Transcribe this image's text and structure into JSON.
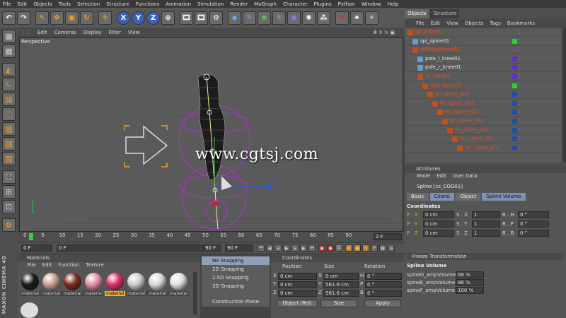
{
  "menubar": [
    "File",
    "Edit",
    "Objects",
    "Tools",
    "Selection",
    "Structure",
    "Functions",
    "Animation",
    "Simulation",
    "Render",
    "MoGraph",
    "Character",
    "Plugins",
    "Python",
    "Window",
    "Help"
  ],
  "toolbar": {
    "axis_x": "X",
    "axis_y": "Y",
    "axis_z": "Z"
  },
  "viewport": {
    "menu": [
      "Edit",
      "Cameras",
      "Display",
      "Filter",
      "View"
    ],
    "label": "Perspective",
    "watermark": "www.cgtsj.com"
  },
  "timeline": {
    "ticks": [
      "0",
      "5",
      "10",
      "15",
      "20",
      "25",
      "30",
      "35",
      "40",
      "45",
      "50",
      "55",
      "60",
      "65",
      "70",
      "75",
      "80",
      "85",
      "90"
    ],
    "end_label": "2 F",
    "current_frame": "0 F",
    "start_frame": "0 F",
    "end_frame": "90 F",
    "preview_end": "90 F"
  },
  "materials": {
    "title": "Materials",
    "menu": [
      "File",
      "Edit",
      "Function",
      "Texture"
    ],
    "items": [
      {
        "name": "material",
        "color": "#1a1a1a"
      },
      {
        "name": "material",
        "color": "#c8a090"
      },
      {
        "name": "material",
        "color": "#7a2a1a"
      },
      {
        "name": "material",
        "color": "#e890a8"
      },
      {
        "name": "material",
        "color": "#e0306a"
      },
      {
        "name": "material",
        "color": "#cccccc"
      },
      {
        "name": "material",
        "color": "#d8d8d8"
      },
      {
        "name": "material",
        "color": "#e0e0e0"
      }
    ],
    "selected_index": 4
  },
  "snapping": {
    "items": [
      "No Snapping",
      "2D Snapping",
      "2.5D Snapping",
      "3D Snapping",
      "Construction Plane"
    ],
    "active_index": 0
  },
  "coordinates": {
    "title": "Coordinates",
    "headers": [
      "Position",
      "Size",
      "Rotation"
    ],
    "rows": [
      {
        "axis": "X",
        "pos": "0 cm",
        "size": "0 cm",
        "rot_axis": "H",
        "rot": "0 °"
      },
      {
        "axis": "Y",
        "pos": "0 cm",
        "size": "561.6 cm",
        "rot_axis": "P",
        "rot": "0 °"
      },
      {
        "axis": "Z",
        "pos": "0 cm",
        "size": "561.6 cm",
        "rot_axis": "B",
        "rot": "0 °"
      }
    ],
    "mode": "Object (Rel)",
    "size_mode": "Size",
    "apply": "Apply"
  },
  "objects_panel": {
    "tabs": [
      "Objects",
      "Structure"
    ],
    "menu": [
      "File",
      "Edit",
      "View",
      "Objects",
      "Tags",
      "Bookmarks"
    ],
    "rows": [
      {
        "name": "sdcontrols",
        "indent": 0,
        "color": "",
        "red": true
      },
      {
        "name": "spl_spine01",
        "indent": 1,
        "color": "#30d030",
        "red": false
      },
      {
        "name": "ctGlobalMove01",
        "indent": 1,
        "color": "",
        "red": true
      },
      {
        "name": "pole_l_knee01",
        "indent": 2,
        "color": "#6030c0",
        "red": false
      },
      {
        "name": "pole_r_knee01",
        "indent": 2,
        "color": "#6030c0",
        "red": false
      },
      {
        "name": "cs_COG01",
        "indent": 2,
        "color": "#6030c0",
        "red": true
      },
      {
        "name": "mid_spine01",
        "indent": 3,
        "color": "#30d030",
        "red": true
      },
      {
        "name": "tin_spine_a01",
        "indent": 4,
        "color": "#2050a0",
        "red": true
      },
      {
        "name": "tin_spine_b01",
        "indent": 5,
        "color": "#2050a0",
        "red": true
      },
      {
        "name": "tin_spine_c01",
        "indent": 6,
        "color": "#2050a0",
        "red": true
      },
      {
        "name": "tin_spine_d01",
        "indent": 7,
        "color": "#2050a0",
        "red": true
      },
      {
        "name": "tin_spine_e01",
        "indent": 8,
        "color": "#2050a0",
        "red": true
      },
      {
        "name": "tin_spine_f01",
        "indent": 9,
        "color": "#2050a0",
        "red": true
      },
      {
        "name": "tin_spine_g01",
        "indent": 10,
        "color": "#2050a0",
        "red": true
      }
    ]
  },
  "attributes": {
    "title": "Attributes",
    "menu": [
      "Mode",
      "Edit",
      "User Data"
    ],
    "object_name": "Spline [cs_COG01]",
    "tabs": [
      "Basic",
      "Coord.",
      "Object",
      "Spline Volume"
    ],
    "active_tabs": [
      1,
      3
    ],
    "coords_title": "Coordinates",
    "coord_rows": [
      {
        "p": "P . X",
        "pv": "0 cm",
        "s": "S . X",
        "sv": "1",
        "r": "R . H",
        "rv": "0 °"
      },
      {
        "p": "P . Y",
        "pv": "0 cm",
        "s": "S . Y",
        "sv": "1",
        "r": "R . P",
        "rv": "0 °"
      },
      {
        "p": "P . Z",
        "pv": "0 cm",
        "s": "S . Z",
        "sv": "1",
        "r": "R . B",
        "rv": "0 °"
      }
    ],
    "freeze": "Freeze Transformation",
    "spline_title": "Spline Volume",
    "spline_rows": [
      {
        "label": "spineD_ampVolume",
        "value": "68 %"
      },
      {
        "label": "spineE_ampVolume",
        "value": "86 %"
      },
      {
        "label": "spineF_ampVolume",
        "value": "100 %"
      }
    ]
  }
}
